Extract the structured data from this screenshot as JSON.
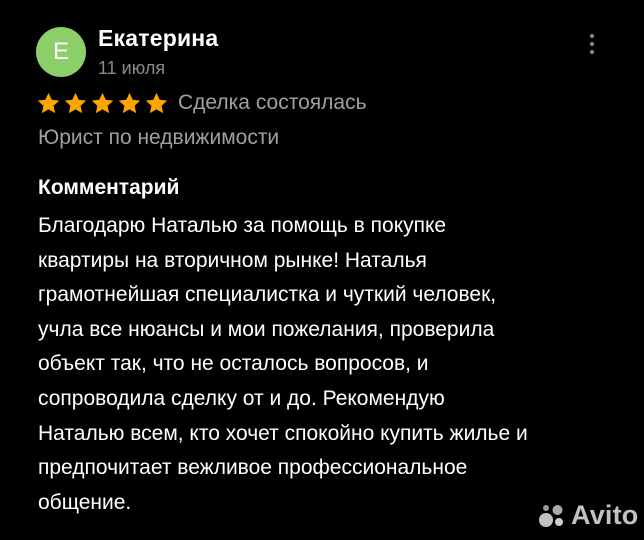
{
  "review": {
    "author": {
      "initial": "Е",
      "name": "Екатерина",
      "avatar_color": "#8ccf69"
    },
    "date": "11 июля",
    "menu_icon": "more-vertical-icon",
    "rating": {
      "stars": 5,
      "max": 5,
      "star_color": "#ffa500"
    },
    "deal_status": "Сделка состоялась",
    "service": "Юрист по недвижимости",
    "comment": {
      "heading": "Комментарий",
      "lines": [
        "Благодарю Наталью за помощь в покупке",
        "квартиры на вторичном рынке! Наталья",
        "грамотнейшая специалистка и чуткий человек,",
        "учла все нюансы и мои пожелания, проверила",
        "объект так, что не осталось вопросов, и",
        "сопроводила сделку от и до. Рекомендую",
        "Наталью всем, кто хочет спокойно купить жилье и",
        "предпочитает вежливое профессиональное",
        "общение."
      ]
    }
  },
  "watermark": {
    "text": "Avito",
    "icon": "avito-logo-icon",
    "colors": [
      "#d8d8d8",
      "#bdbdbd",
      "#e6e6e6",
      "#a8a8a8"
    ]
  }
}
